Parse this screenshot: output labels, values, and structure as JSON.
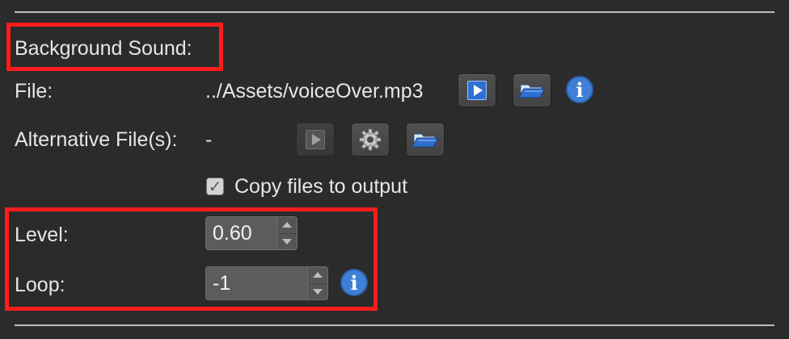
{
  "section": {
    "title": "Background Sound:"
  },
  "file": {
    "label": "File:",
    "value": "../Assets/voiceOver.mp3"
  },
  "alt_files": {
    "label": "Alternative File(s):",
    "value": "-"
  },
  "copy_files": {
    "label": "Copy files to output",
    "checked": true
  },
  "level": {
    "label": "Level:",
    "value": "0.60"
  },
  "loop": {
    "label": "Loop:",
    "value": "-1"
  },
  "icons": {
    "info_glyph": "i",
    "check_glyph": "✓"
  },
  "colors": {
    "background": "#2b2b2b",
    "highlight": "#ff1c1c",
    "accent": "#3f7fd6"
  }
}
